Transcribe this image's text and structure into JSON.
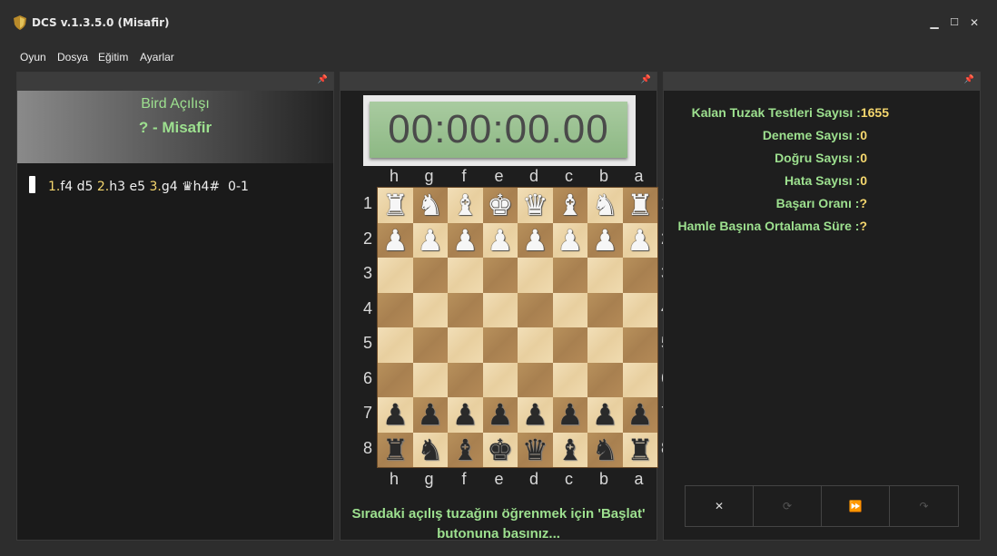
{
  "window": {
    "title": "DCS v.1.3.5.0 (Misafir)",
    "minimize_glyph": "▁",
    "maximize_glyph": "☐",
    "close_glyph": "✕"
  },
  "menu": {
    "items": [
      "Oyun",
      "Dosya",
      "Eğitim",
      "Ayarlar"
    ]
  },
  "left_panel": {
    "opening_name": "Bird Açılışı",
    "player_line": "? - Misafir",
    "moves": [
      {
        "num": "1.",
        "text": "f4 d5 "
      },
      {
        "num": "2.",
        "text": "h3 e5 "
      },
      {
        "num": "3.",
        "text": "g4 "
      }
    ],
    "final_move": "♛h4#",
    "result": "0-1"
  },
  "center_panel": {
    "clock": "00:00:00.00",
    "files": [
      "h",
      "g",
      "f",
      "e",
      "d",
      "c",
      "b",
      "a"
    ],
    "ranks": [
      "1",
      "2",
      "3",
      "4",
      "5",
      "6",
      "7",
      "8"
    ],
    "board_rows": [
      [
        "R",
        "N",
        "B",
        "K",
        "Q",
        "B",
        "N",
        "R"
      ],
      [
        "P",
        "P",
        "P",
        "P",
        "P",
        "P",
        "P",
        "P"
      ],
      [
        "",
        "",
        "",
        "",
        "",
        "",
        "",
        ""
      ],
      [
        "",
        "",
        "",
        "",
        "",
        "",
        "",
        ""
      ],
      [
        "",
        "",
        "",
        "",
        "",
        "",
        "",
        ""
      ],
      [
        "",
        "",
        "",
        "",
        "",
        "",
        "",
        ""
      ],
      [
        "p",
        "p",
        "p",
        "p",
        "p",
        "p",
        "p",
        "p"
      ],
      [
        "r",
        "n",
        "b",
        "k",
        "q",
        "b",
        "n",
        "r"
      ]
    ],
    "message_line1": "Sıradaki açılış tuzağını öğrenmek için 'Başlat'",
    "message_line2": "butonuna basınız..."
  },
  "right_panel": {
    "stats": [
      {
        "label": "Kalan Tuzak Testleri Sayısı :",
        "value": "1655"
      },
      {
        "label": "Deneme Sayısı :",
        "value": "0"
      },
      {
        "label": "Doğru Sayısı :",
        "value": "0"
      },
      {
        "label": "Hata Sayısı :",
        "value": "0"
      },
      {
        "label": "Başarı Oranı :",
        "value": "?"
      },
      {
        "label": "Hamle Başına Ortalama Süre :",
        "value": "?"
      }
    ],
    "controls": [
      {
        "name": "close-test-button",
        "glyph": "✕",
        "disabled": false
      },
      {
        "name": "refresh-button",
        "glyph": "⟳",
        "disabled": true
      },
      {
        "name": "fast-forward-button",
        "glyph": "⏩",
        "disabled": false
      },
      {
        "name": "redo-button",
        "glyph": "↷",
        "disabled": true
      }
    ]
  },
  "colors": {
    "accent_green": "#9de08f",
    "accent_yellow": "#f5d76e",
    "background": "#2d2d2d",
    "panel_bg": "#1e1e1e"
  },
  "icons": {
    "app": "shield-icon",
    "pin": "pin-icon"
  }
}
